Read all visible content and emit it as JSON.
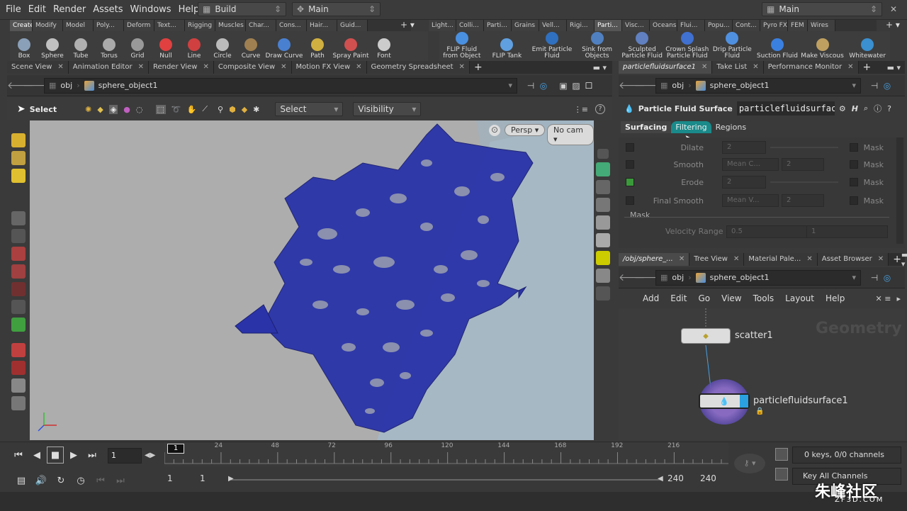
{
  "menu": [
    "File",
    "Edit",
    "Render",
    "Assets",
    "Windows",
    "Help"
  ],
  "desktop": "Build",
  "context": "Main",
  "right_context": "Main",
  "shelf_tabs_left": [
    "Create",
    "Modify",
    "Model",
    "Poly...",
    "Deform",
    "Text...",
    "Rigging",
    "Muscles",
    "Char...",
    "Cons...",
    "Hair...",
    "Guid..."
  ],
  "shelf_tabs_right": [
    "Light...",
    "Colli...",
    "Parti...",
    "Grains",
    "Vell...",
    "Rigi...",
    "Parti...",
    "Visc...",
    "Oceans",
    "Flui...",
    "Popu...",
    "Cont...",
    "Pyro FX",
    "FEM",
    "Wires"
  ],
  "tools_left": [
    "Box",
    "Sphere",
    "Tube",
    "Torus",
    "Grid",
    "Null",
    "Line",
    "Circle",
    "Curve",
    "Draw Curve",
    "Path",
    "Spray Paint",
    "Font"
  ],
  "tools_right": [
    "FLIP Fluid from Object",
    "FLIP Tank",
    "Emit Particle Fluid",
    "Sink from Objects",
    "Sculpted Particle Fluid",
    "Crown Splash Particle Fluid",
    "Drip Particle Fluid",
    "Suction Fluid",
    "Make Viscous",
    "Whitewater"
  ],
  "left_pane_tabs": [
    "Scene View",
    "Animation Editor",
    "Render View",
    "Composite View",
    "Motion FX View",
    "Geometry Spreadsheet"
  ],
  "right_top_tabs": [
    "particlefluidsurface1",
    "Take List",
    "Performance Monitor"
  ],
  "path": {
    "network": "obj",
    "node": "sphere_object1"
  },
  "viewer": {
    "select_tool": "Select",
    "select_dd": "Select",
    "visibility_dd": "Visibility",
    "camera": "Persp",
    "nocam": "No cam"
  },
  "params": {
    "node_type": "Particle Fluid Surface",
    "node_name": "particlefluidsurfac",
    "tabs": [
      "Surfacing",
      "Filtering",
      "Regions"
    ],
    "rows": [
      {
        "label": "Dilate",
        "method": "",
        "val": "2",
        "mask": "Mask",
        "checked": false
      },
      {
        "label": "Smooth",
        "method": "Mean C...",
        "val": "2",
        "mask": "Mask",
        "checked": false
      },
      {
        "label": "Erode",
        "method": "",
        "val": "2",
        "mask": "Mask",
        "checked": true
      },
      {
        "label": "Final Smooth",
        "method": "Mean V...",
        "val": "2",
        "mask": "Mask",
        "checked": false
      }
    ],
    "mask_section": "Mask",
    "velocity_label": "Velocity Range",
    "velocity_min": "0.5",
    "velocity_max": "1"
  },
  "net_tabs": [
    "/obj/sphere_...",
    "Tree View",
    "Material Pale...",
    "Asset Browser"
  ],
  "net_menu": [
    "Add",
    "Edit",
    "Go",
    "View",
    "Tools",
    "Layout",
    "Help"
  ],
  "net_watermark": "Geometry",
  "nodes": [
    {
      "name": "scatter1"
    },
    {
      "name": "particlefluidsurface1"
    }
  ],
  "timeline": {
    "frame": "1",
    "ticks": [
      "24",
      "48",
      "72",
      "96",
      "120",
      "144",
      "168",
      "192",
      "216"
    ],
    "current_marker": "1",
    "start": "1",
    "start2": "1",
    "end": "240",
    "end2": "240",
    "keys_info": "0 keys, 0/0 channels",
    "key_all": "Key All Channels"
  },
  "watermark": {
    "brand": "朱峰社区",
    "url": "ZF3D.COM"
  },
  "colors": {
    "accent_teal": "#1a8a8a",
    "mesh_blue": "#2a33a8",
    "selected_node": "#2aa0e0"
  }
}
